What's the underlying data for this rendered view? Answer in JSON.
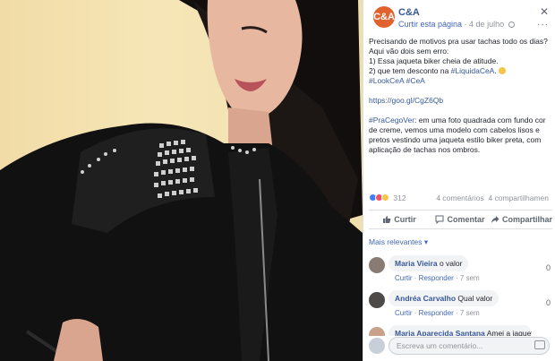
{
  "photo": {
    "alt_icon": "woman-in-black-studded-leather-jacket"
  },
  "header": {
    "page_avatar_text": "C&A",
    "page_name": "C&A",
    "follow_label": "Curtir esta página",
    "separator": " · ",
    "date": "4 de julho",
    "close_icon": "close-icon",
    "more_label": "···"
  },
  "post": {
    "line1": "Precisando de motivos pra usar tachas todo os dias? Aqui vão dois sem erro:",
    "line2": "1) Essa jaqueta biker cheia de atitude.",
    "line3_prefix": "2) que tem desconto na ",
    "line3_tag": "#LiquidaCeA",
    "line3_suffix": ". ",
    "tags_line": "#LookCeA #CeA",
    "link": "https://goo.gl/CgZ6Qb",
    "accessibility_tag": "#PraCegoVer",
    "accessibility_text": ": em uma foto quadrada com fundo cor de creme, vemos uma modelo com cabelos lisos e pretos vestindo uma jaqueta estilo biker preta, com aplicação de tachas nos ombros."
  },
  "reactions": {
    "count": "312",
    "comments": "4 comentários",
    "shares": "4 compartilhamen"
  },
  "actions": {
    "like": "Curtir",
    "comment": "Comentar",
    "share": "Compartilhar"
  },
  "relevant_label": "Mais relevantes ▾",
  "comments": [
    {
      "name": "Maria Vieira",
      "text": "o valor",
      "like": "Curtir",
      "reply": "Responder",
      "time": "7 sem",
      "count": "0"
    },
    {
      "name": "Andréa Carvalho",
      "text": "Qual valor",
      "like": "Curtir",
      "reply": "Responder",
      "time": "7 sem",
      "count": "0"
    },
    {
      "name": "Maria Aparecida Santana",
      "text": "Amei a jaqueta",
      "like": "",
      "reply": "",
      "time": "",
      "count": ""
    }
  ],
  "compose": {
    "placeholder": "Escreva um comentário..."
  }
}
